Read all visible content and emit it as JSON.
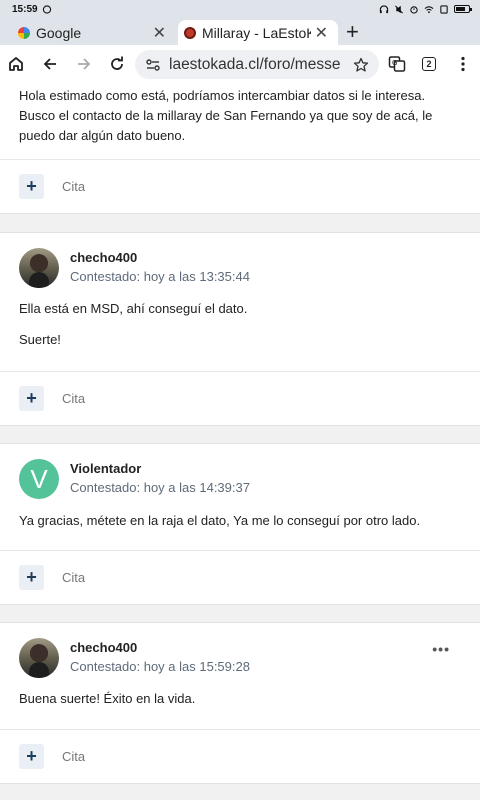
{
  "status_bar": {
    "time": "15:59"
  },
  "tabs": [
    {
      "title": "Google",
      "favicon": "google-icon",
      "active": false
    },
    {
      "title": "Millaray - LaEstoKada",
      "favicon": "site-icon",
      "active": true
    }
  ],
  "toolbar": {
    "url": "laestokada.cl/foro/messenger",
    "tab_count": "2"
  },
  "posts": [
    {
      "text": "Hola estimado como está, podríamos intercambiar datos si le interesa. Busco el contacto de la millaray de San Fernando ya que soy de acá, le puedo dar algún dato bueno.",
      "quote_label": "Cita"
    },
    {
      "username": "checho400",
      "timestamp": "Contestado: hoy a las 13:35:44",
      "avatar_type": "photo",
      "paragraphs": [
        "Ella está en MSD, ahí conseguí el dato.",
        "Suerte!"
      ],
      "quote_label": "Cita"
    },
    {
      "username": "Violentador",
      "timestamp": "Contestado: hoy a las 14:39:37",
      "avatar_type": "letter",
      "avatar_letter": "V",
      "paragraphs": [
        "Ya gracias, métete en la raja el dato, Ya me lo conseguí por otro lado."
      ],
      "quote_label": "Cita"
    },
    {
      "username": "checho400",
      "timestamp": "Contestado: hoy a las 15:59:28",
      "avatar_type": "photo",
      "paragraphs": [
        "Buena suerte! Éxito en la vida."
      ],
      "quote_label": "Cita",
      "menu": "•••"
    }
  ],
  "colors": {
    "accent": "#1d3b5b",
    "quote_button_bg": "#e9eff5",
    "letter_avatar_bg": "#55c39a",
    "timestamp": "#5f6b7a"
  }
}
